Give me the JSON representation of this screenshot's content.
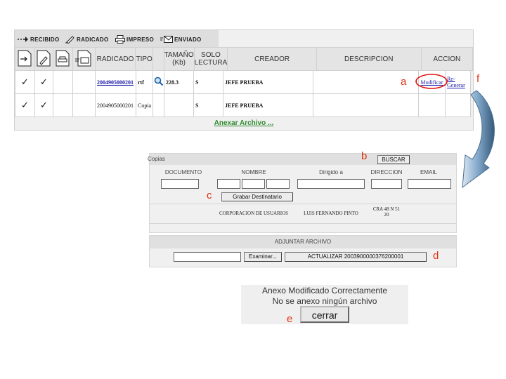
{
  "tabs": [
    {
      "label": "RECIBIDO",
      "icon": "arrow-icon"
    },
    {
      "label": "RADICADO",
      "icon": "pencil-icon"
    },
    {
      "label": "IMPRESO",
      "icon": "printer-icon"
    },
    {
      "label": "ENVIADO",
      "icon": "envelope-icon"
    }
  ],
  "table": {
    "headers": {
      "radicado": "RADICADO",
      "tipo": "TIPO",
      "tamano_1": "TAMAÑO",
      "tamano_2": "(Kb)",
      "solo_1": "SOLO",
      "solo_2": "LECTURA",
      "creador": "CREADOR",
      "descripcion": "DESCRIPCION",
      "accion": "ACCION"
    },
    "rows": [
      {
        "check1": "✓",
        "check2": "✓",
        "radicado": "2004905000201",
        "tipo": "rtf",
        "tamano": "228.3",
        "solo": "S",
        "creador": "JEFE PRUEBA",
        "accion1": "Modificar",
        "accion2a": "Re-",
        "accion2b": "Generar"
      },
      {
        "check1": "✓",
        "check2": "✓",
        "radicado": "2004905000201",
        "tipo": "Copia",
        "tamano": "",
        "solo": "S",
        "creador": "JEFE PRUEBA"
      }
    ],
    "anexar": "Anexar Archivo ..."
  },
  "markers": {
    "a": "a",
    "b": "b",
    "c": "c",
    "d": "d",
    "e": "e",
    "f": "f"
  },
  "copias": {
    "title": "Copias",
    "buscar": "BUSCAR",
    "headers": {
      "documento": "DOCUMENTO",
      "nombre": "NOMBRE",
      "dirigido": "Dirigido a",
      "direccion": "DIRECCION",
      "email": "EMAIL"
    },
    "grabar": "Grabar Destinatario",
    "result": {
      "nombre": "CORPORACION DE USUARIOS",
      "dirigido": "LUIS FERNANDO PINTO",
      "direccion_1": "CRA 48 N 51",
      "direccion_2": "20"
    }
  },
  "adjuntar": {
    "title": "ADJUNTAR ARCHIVO",
    "examinar": "Examinar...",
    "actualizar": "ACTUALIZAR 2003900000376200001"
  },
  "message": {
    "line1": "Anexo Modificado Correctamente",
    "line2": "No se anexo ningún archivo",
    "cerrar": "cerrar"
  },
  "colors": {
    "accent_red": "#e03010",
    "link_blue": "#1a1aa8",
    "arrow_blue": "#7fa6c8",
    "anexar_green": "#2e8b2e"
  }
}
